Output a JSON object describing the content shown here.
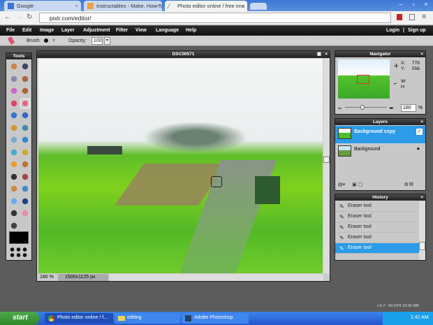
{
  "browser": {
    "tabs": [
      {
        "label": "Google"
      },
      {
        "label": "Instructables - Make, How To"
      },
      {
        "label": "Photo editor online / free ima",
        "active": true
      }
    ],
    "url": "pixlr.com/editor/"
  },
  "menu": {
    "items": [
      "File",
      "Edit",
      "Image",
      "Layer",
      "Adjustment",
      "Filter",
      "View",
      "Language",
      "Help"
    ],
    "login": "Login",
    "separator": "|",
    "signup": "Sign up"
  },
  "options": {
    "brush_label": "Brush:",
    "opacity_label": "Opacity:",
    "opacity_value": "100"
  },
  "tools": {
    "title": "Tools",
    "items": [
      "crop",
      "move",
      "marquee",
      "lasso",
      "wand",
      "pencil",
      "brush",
      "eraser",
      "bucket",
      "gradient",
      "clone",
      "color-replace",
      "drawing",
      "blur",
      "sharpen",
      "smudge",
      "sponge",
      "dodge",
      "burn",
      "red-eye",
      "spot-heal",
      "bloat",
      "pinch",
      "picker",
      "type",
      "hand",
      "zoom"
    ]
  },
  "canvas": {
    "title": "DSC00571",
    "zoom": "180",
    "zoom_unit": "%",
    "size": "1500x1125 px"
  },
  "navigator": {
    "title": "Navigator",
    "x_label": "X:",
    "x": "779",
    "y_label": "Y:",
    "y": "556",
    "w_label": "W:",
    "h_label": "H:",
    "zoom": "180",
    "unit": "%"
  },
  "layers": {
    "title": "Layers",
    "items": [
      {
        "name": "Background copy",
        "selected": true
      },
      {
        "name": "Background",
        "locked": true
      }
    ]
  },
  "history": {
    "title": "History",
    "items": [
      "Eraser tool",
      "Eraser tool",
      "Eraser tool",
      "Eraser tool",
      "Eraser tool"
    ],
    "selected": 4
  },
  "status": "v.5.7 - 60 FPS 10.96 MB",
  "taskbar": {
    "start": "start",
    "items": [
      "Photo editor online / f...",
      "editing",
      "Adobe Photoshop"
    ],
    "clock": "1:42 AM"
  },
  "colors": {
    "accent": "#2c9be8",
    "menubar": "#1a1a1a",
    "workspace": "#5c5c5c"
  }
}
